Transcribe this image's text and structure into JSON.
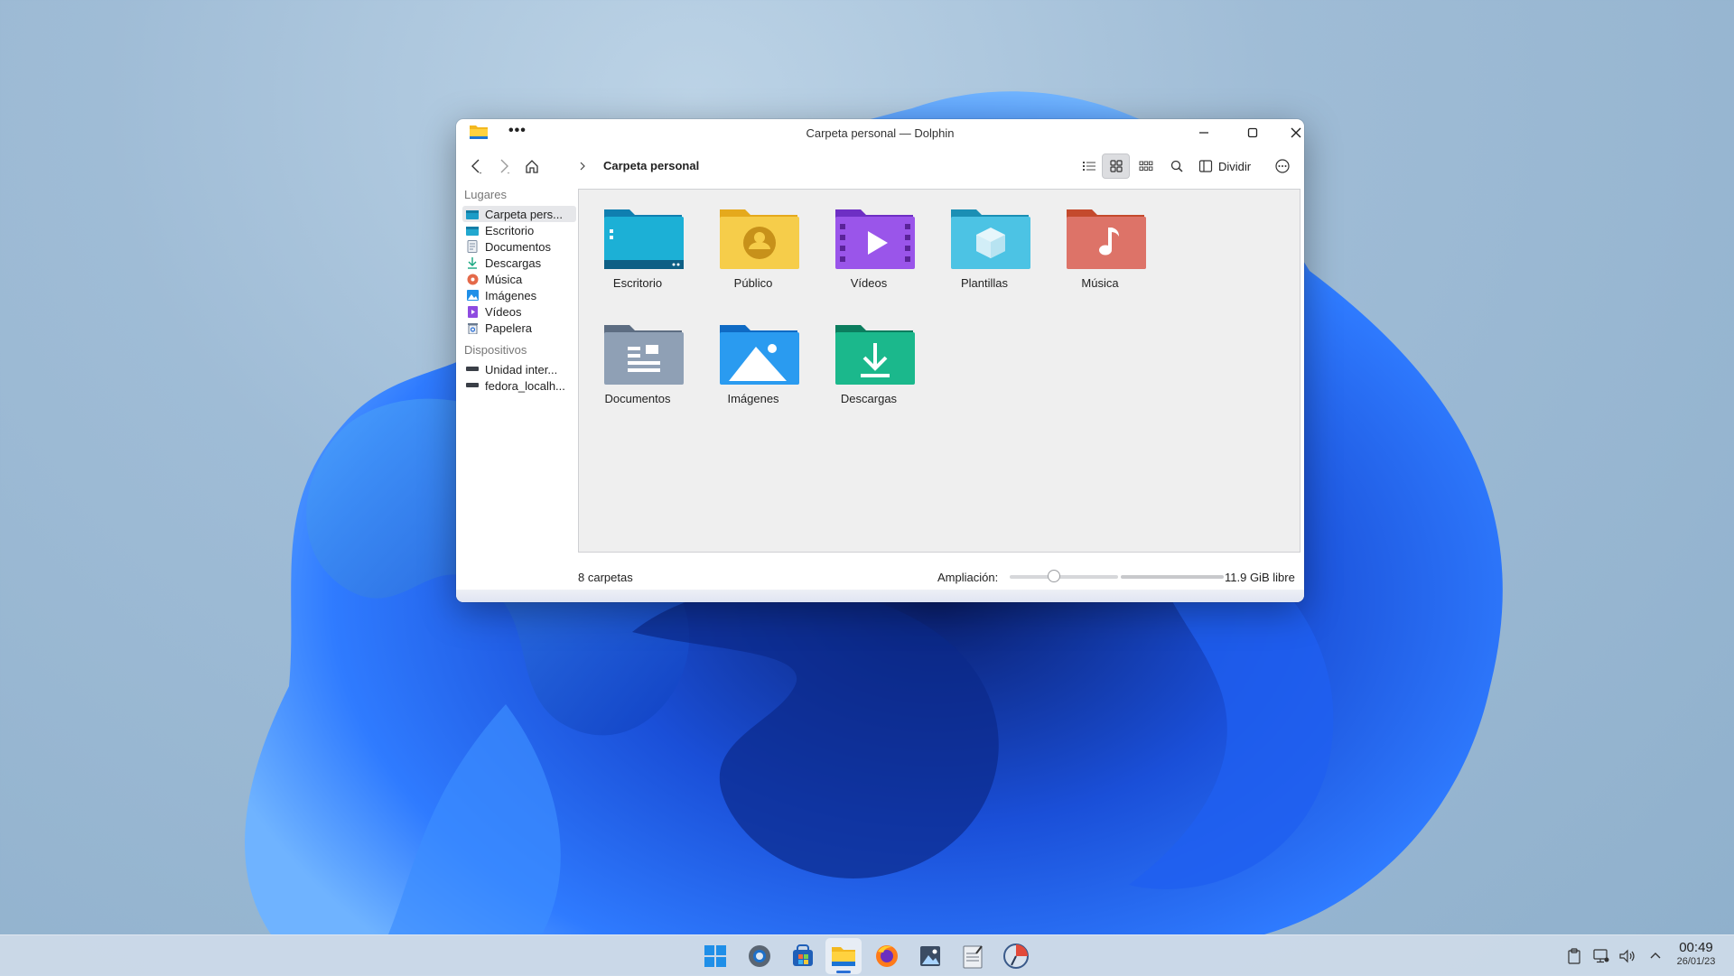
{
  "window": {
    "title": "Carpeta personal — Dolphin",
    "breadcrumb": "Carpeta personal",
    "split_label": "Dividir"
  },
  "sidebar": {
    "places_title": "Lugares",
    "places": [
      {
        "label": "Carpeta pers...",
        "icon": "home-folder-icon"
      },
      {
        "label": "Escritorio",
        "icon": "desktop-folder-icon"
      },
      {
        "label": "Documentos",
        "icon": "documents-icon"
      },
      {
        "label": "Descargas",
        "icon": "downloads-icon"
      },
      {
        "label": "Música",
        "icon": "music-icon"
      },
      {
        "label": "Imágenes",
        "icon": "pictures-icon"
      },
      {
        "label": "Vídeos",
        "icon": "videos-icon"
      },
      {
        "label": "Papelera",
        "icon": "trash-icon"
      }
    ],
    "devices_title": "Dispositivos",
    "devices": [
      {
        "label": "Unidad inter...",
        "icon": "drive-icon"
      },
      {
        "label": "fedora_localh...",
        "icon": "drive-icon"
      }
    ]
  },
  "folders": [
    {
      "label": "Escritorio",
      "icon": "desktop-folder-icon",
      "color": "#1aa3c8"
    },
    {
      "label": "Público",
      "icon": "public-folder-icon",
      "color": "#f1c232"
    },
    {
      "label": "Vídeos",
      "icon": "videos-folder-icon",
      "color": "#8e4be0"
    },
    {
      "label": "Plantillas",
      "icon": "templates-folder-icon",
      "color": "#3fb6d8"
    },
    {
      "label": "Música",
      "icon": "music-folder-icon",
      "color": "#e46a4a"
    },
    {
      "label": "Documentos",
      "icon": "documents-folder-icon",
      "color": "#7f8fa3"
    },
    {
      "label": "Imágenes",
      "icon": "pictures-folder-icon",
      "color": "#1f8fe8"
    },
    {
      "label": "Descargas",
      "icon": "downloads-folder-icon",
      "color": "#17a67f"
    }
  ],
  "status": {
    "count": "8 carpetas",
    "zoom_label": "Ampliación:",
    "free_space": "11.9 GiB libre",
    "zoom_level": 0.4
  },
  "taskbar": {
    "apps": [
      "start-menu-icon",
      "settings-icon",
      "discover-icon",
      "file-manager-icon",
      "firefox-icon",
      "image-viewer-icon",
      "text-editor-icon",
      "system-monitor-icon"
    ],
    "time": "00:49",
    "date": "26/01/23"
  },
  "colors": {
    "accent": "#2a6fd6"
  }
}
